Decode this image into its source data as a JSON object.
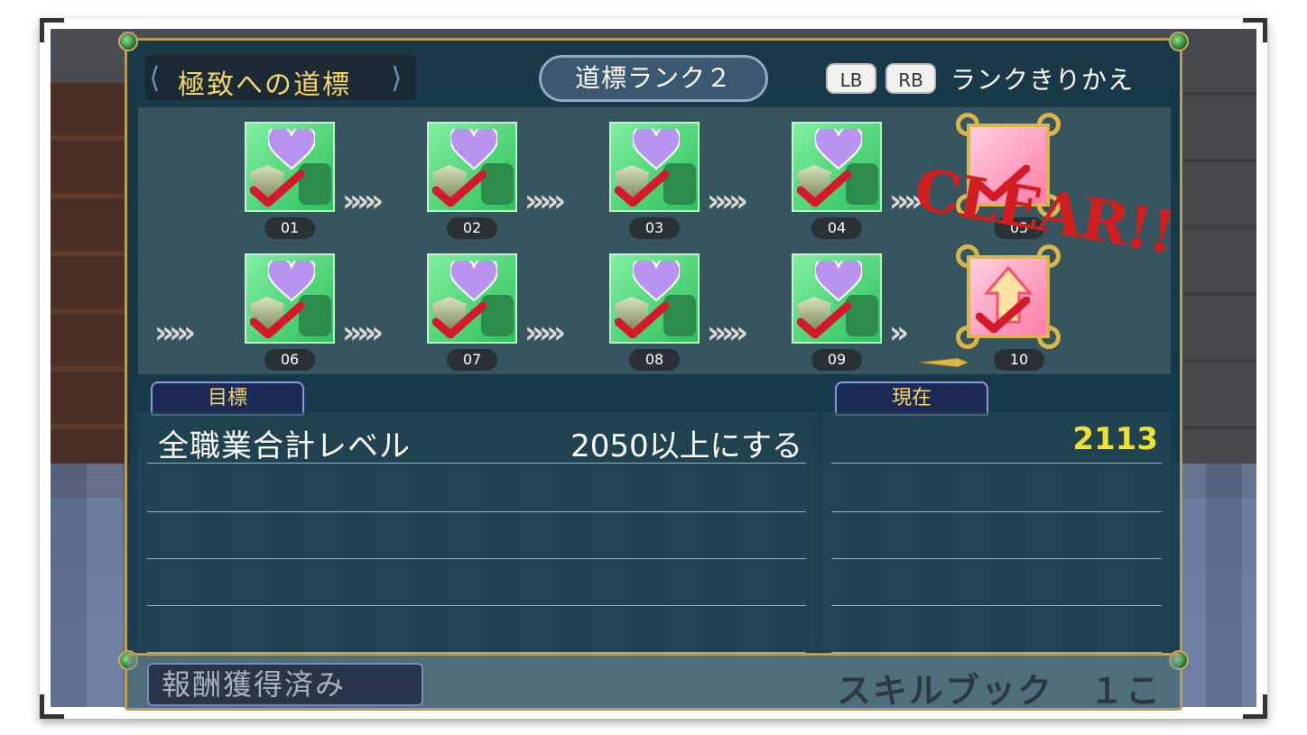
{
  "header": {
    "title": "極致への道標",
    "rank": "道標ランク２",
    "lb_key": "LB",
    "rb_key": "RB",
    "switch_label": "ランクきりかえ"
  },
  "milestones": [
    {
      "label": "01",
      "type": "green",
      "cleared": true
    },
    {
      "label": "02",
      "type": "green",
      "cleared": true
    },
    {
      "label": "03",
      "type": "green",
      "cleared": true
    },
    {
      "label": "04",
      "type": "green",
      "cleared": true
    },
    {
      "label": "05",
      "type": "gold",
      "cleared": true
    },
    {
      "label": "06",
      "type": "green",
      "cleared": true
    },
    {
      "label": "07",
      "type": "green",
      "cleared": true
    },
    {
      "label": "08",
      "type": "green",
      "cleared": true
    },
    {
      "label": "09",
      "type": "green",
      "cleared": true
    },
    {
      "label": "10",
      "type": "gold",
      "cleared": true
    }
  ],
  "clear_stamp": "CLEAR!!",
  "goal": {
    "tab_label": "目標",
    "text": "全職業合計レベル",
    "requirement": "2050以上にする"
  },
  "current": {
    "tab_label": "現在",
    "value": "2113"
  },
  "reward": {
    "status_label": "報酬獲得済み",
    "item": "スキルブック　１こ"
  },
  "colors": {
    "gold_text": "#f3d56a",
    "current_value": "#f2e12c",
    "clear_red": "#d11f1f",
    "frame_gold": "#b89a5a"
  }
}
